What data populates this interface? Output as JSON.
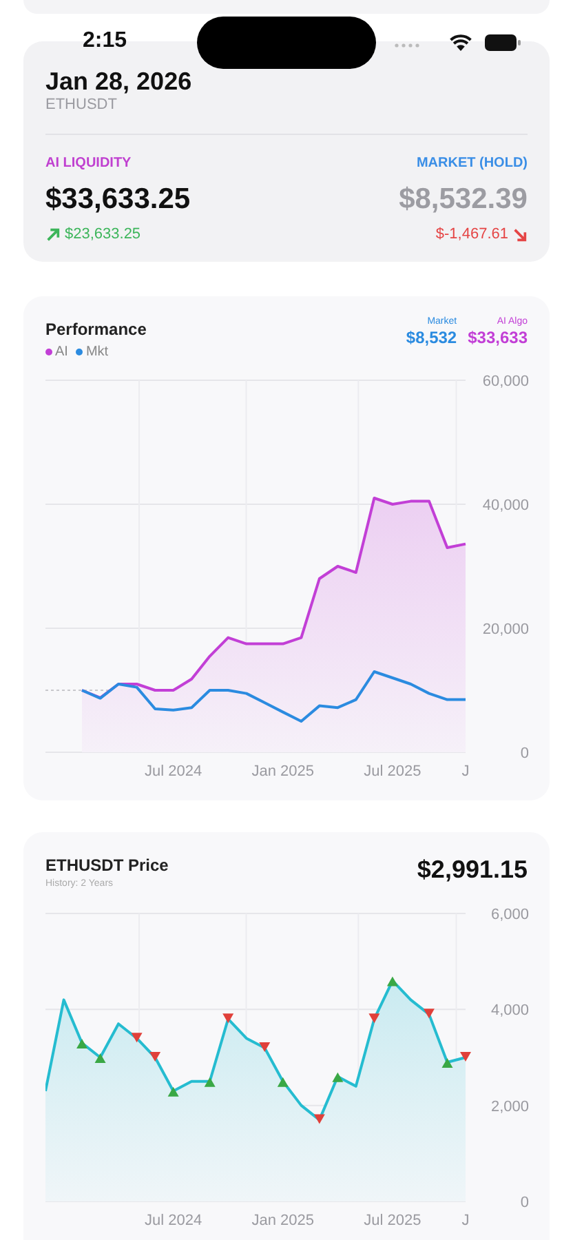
{
  "status_bar": {
    "time": "2:15"
  },
  "summary": {
    "date": "Jan 28, 2026",
    "symbol": "ETHUSDT",
    "ai": {
      "label": "AI LIQUIDITY",
      "value": "$33,633.25",
      "change": "$23,633.25",
      "positive": true
    },
    "market": {
      "label": "MARKET (HOLD)",
      "value": "$8,532.39",
      "change": "$-1,467.61",
      "positive": false
    }
  },
  "performance": {
    "title": "Performance",
    "summary": [
      {
        "label": "Market",
        "value": "$8,532",
        "color": "#2b8be0"
      },
      {
        "label": "AI Algo",
        "value": "$33,633",
        "color": "#c23fd6"
      }
    ],
    "chart_data": {
      "type": "area",
      "grid": true,
      "categories": [
        null,
        null,
        null,
        null,
        null,
        null,
        null,
        "Jul 2024",
        null,
        null,
        null,
        null,
        null,
        "Jan 2025",
        null,
        null,
        null,
        null,
        null,
        "Jul 2025",
        null,
        null,
        null,
        "J"
      ],
      "series": [
        {
          "name": "AI",
          "type": "area",
          "color": "#c23fd6",
          "values": [
            null,
            null,
            10000,
            8800,
            11000,
            11000,
            10000,
            10000,
            11800,
            15500,
            18500,
            17500,
            17500,
            17500,
            18500,
            28000,
            30000,
            29000,
            41000,
            40000,
            40500,
            40500,
            33000,
            33600
          ]
        },
        {
          "name": "Mkt",
          "type": "line",
          "color": "#2b8be0",
          "values": [
            null,
            null,
            10000,
            8700,
            11000,
            10500,
            7000,
            6800,
            7200,
            10000,
            10000,
            9500,
            8000,
            6500,
            5000,
            7500,
            7200,
            8500,
            13000,
            12000,
            11000,
            9500,
            8500,
            8500
          ]
        }
      ],
      "ylim": [
        0,
        60000
      ],
      "yticks": [
        {
          "value": 0,
          "label": "0"
        },
        {
          "value": 20000,
          "label": "20,000"
        },
        {
          "value": 40000,
          "label": "40,000"
        },
        {
          "value": 60000,
          "label": "60,000"
        }
      ],
      "ref_lines": [
        {
          "axis": "y",
          "value": 10000
        }
      ]
    }
  },
  "price": {
    "title": "ETHUSDT Price",
    "subtitle": "History: 2 Years",
    "value": "$2,991.15",
    "chart_data": {
      "type": "area",
      "grid": true,
      "categories": [
        null,
        null,
        null,
        null,
        null,
        null,
        null,
        "Jul 2024",
        null,
        null,
        null,
        null,
        null,
        "Jan 2025",
        null,
        null,
        null,
        null,
        null,
        "Jul 2025",
        null,
        null,
        null,
        "J"
      ],
      "series": [
        {
          "type": "area",
          "color": "#25bcd0",
          "values": [
            2300,
            4200,
            3300,
            3000,
            3700,
            3400,
            3000,
            2300,
            2500,
            2500,
            3800,
            3400,
            3200,
            2500,
            2000,
            1700,
            2600,
            2400,
            3800,
            4600,
            4200,
            3900,
            2900,
            3000
          ]
        },
        {
          "type": "scatter",
          "marker": "triangle-up",
          "color": "#3aa845",
          "values": [
            null,
            null,
            3300,
            3000,
            null,
            null,
            null,
            2300,
            null,
            2500,
            null,
            null,
            null,
            2500,
            null,
            null,
            2600,
            null,
            null,
            4600,
            null,
            null,
            2900,
            null
          ]
        },
        {
          "type": "scatter",
          "marker": "triangle-down",
          "color": "#e0403a",
          "values": [
            null,
            null,
            null,
            null,
            null,
            3400,
            3000,
            null,
            null,
            null,
            3800,
            null,
            3200,
            null,
            null,
            1700,
            null,
            null,
            3800,
            null,
            null,
            3900,
            null,
            3000
          ]
        }
      ],
      "ylim": [
        0,
        6000
      ],
      "yticks": [
        {
          "value": 0,
          "label": "0"
        },
        {
          "value": 2000,
          "label": "2,000"
        },
        {
          "value": 4000,
          "label": "4,000"
        },
        {
          "value": 6000,
          "label": "6,000"
        }
      ]
    }
  }
}
